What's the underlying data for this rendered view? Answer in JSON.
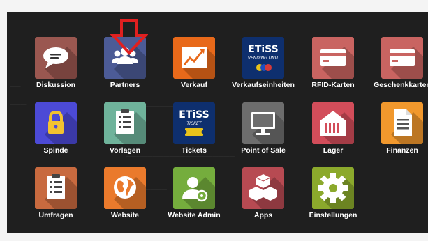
{
  "apps": [
    {
      "label": "Diskussion",
      "color": "#9a5750",
      "icon": "chat-bubble-icon"
    },
    {
      "label": "Partners",
      "color": "#4c5b96",
      "icon": "users-icon"
    },
    {
      "label": "Verkauf",
      "color": "#e8691a",
      "icon": "chart-line-icon"
    },
    {
      "label": "Verkaufseinheiten",
      "color": "#0e2f6e",
      "icon": "etiss-vending-logo-icon",
      "logo_text": "ETiSS",
      "logo_sub": "VENDING UNIT"
    },
    {
      "label": "RFID-Karten",
      "color": "#c96461",
      "icon": "card-icon"
    },
    {
      "label": "Geschenkkarten",
      "color": "#c96461",
      "icon": "card-icon"
    },
    {
      "label": "Spinde",
      "color": "#4c4ad6",
      "icon": "padlock-icon"
    },
    {
      "label": "Vorlagen",
      "color": "#6fb39b",
      "icon": "clipboard-icon"
    },
    {
      "label": "Tickets",
      "color": "#0e2f6e",
      "icon": "etiss-ticket-logo-icon",
      "logo_text": "ETiSS",
      "logo_sub": "TICKET"
    },
    {
      "label": "Point of Sale",
      "color": "#6d6d6d",
      "icon": "monitor-icon"
    },
    {
      "label": "Lager",
      "color": "#d24d5a",
      "icon": "warehouse-icon"
    },
    {
      "label": "Finanzen",
      "color": "#f1982d",
      "icon": "document-icon"
    },
    {
      "label": "Umfragen",
      "color": "#c86a3f",
      "icon": "clipboard-icon"
    },
    {
      "label": "Website",
      "color": "#ea7a2c",
      "icon": "globe-icon"
    },
    {
      "label": "Website Admin",
      "color": "#75ad3d",
      "icon": "user-admin-icon"
    },
    {
      "label": "Apps",
      "color": "#b74a52",
      "icon": "cubes-icon"
    },
    {
      "label": "Einstellungen",
      "color": "#8ba92c",
      "icon": "gear-icon"
    }
  ],
  "highlight": {
    "target": "Partners",
    "color": "#e02020",
    "icon": "down-arrow-icon"
  }
}
